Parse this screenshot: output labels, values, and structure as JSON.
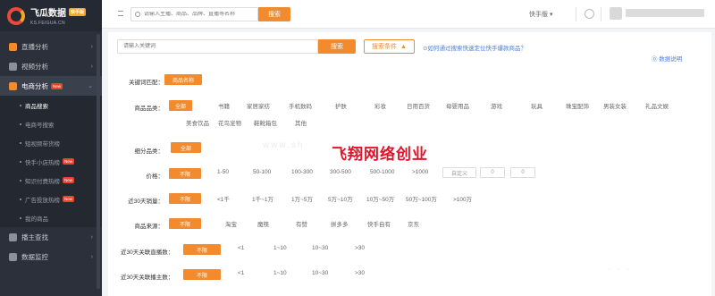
{
  "brand": {
    "title": "飞瓜数据",
    "badge": "快手版",
    "domain": "KS.FEIGUA.CN"
  },
  "sidebar": {
    "items": [
      {
        "label": "直播分析",
        "chevron": "›"
      },
      {
        "label": "视频分析",
        "chevron": "›"
      },
      {
        "label": "电商分析",
        "badge": "New",
        "chevron": "⌄"
      }
    ],
    "subitems": [
      {
        "label": "商品搜索"
      },
      {
        "label": "电商号搜索"
      },
      {
        "label": "短视频带货榜"
      },
      {
        "label": "快手小店热榜",
        "badge": "New"
      },
      {
        "label": "知识付费热榜",
        "badge": "New"
      },
      {
        "label": "广告投放热榜",
        "badge": "New"
      },
      {
        "label": "我的商品"
      }
    ],
    "bottom_items": [
      {
        "label": "播主查找",
        "chevron": "›"
      },
      {
        "label": "数据监控",
        "chevron": "›"
      }
    ]
  },
  "topbar": {
    "search_placeholder": "请输入主播、商品、品牌、直播等名称",
    "search_button": "搜索",
    "platform": "快手版 ▾"
  },
  "main": {
    "keyword_placeholder": "请输入关键词",
    "search_button": "搜索",
    "conditions_button": "搜索条件",
    "conditions_arrow": "▲",
    "help_link": "⊙如何通过搜索快速定位快手爆款商品？",
    "doc_link": "⓪ 数据说明",
    "keyword_match": {
      "label": "关键词匹配：",
      "selected": "商品名称"
    },
    "category": {
      "label": "商品品类：",
      "selected": "全部",
      "options_row1": [
        "书籍",
        "家居家纺",
        "手机数码",
        "护肤",
        "彩妆",
        "日用百货",
        "母婴用品",
        "游戏",
        "玩具",
        "珠宝配饰",
        "男装女装",
        "礼品文娱"
      ],
      "options_row2": [
        "美食饮品",
        "花鸟宠物",
        "鞋靴箱包",
        "其他"
      ]
    },
    "subcategory": {
      "label": "细分品类：",
      "selected": "全部"
    },
    "price": {
      "label": "价格：",
      "selected": "不限",
      "options": [
        "1-50",
        "50-100",
        "100-300",
        "300-500",
        "500-1000",
        ">1000"
      ],
      "custom": "自定义",
      "min": "0",
      "max": "0"
    },
    "sales_30d": {
      "label": "近30天销量：",
      "selected": "不限",
      "options": [
        "<1千",
        "1千~1万",
        "1万~5万",
        "5万~10万",
        "10万~50万",
        "50万~100万",
        ">100万"
      ]
    },
    "source": {
      "label": "商品来源：",
      "selected": "不限",
      "options": [
        "淘宝",
        "魔筷",
        "有赞",
        "拼多多",
        "快手自有",
        "京东"
      ]
    },
    "live_count": {
      "label": "近30天关联直播数：",
      "selected": "不限",
      "options": [
        "<1",
        "1~10",
        "10~30",
        ">30"
      ]
    },
    "streamer_count": {
      "label": "近30天关联播主数：",
      "selected": "不限",
      "options": [
        "<1",
        "1~10",
        "10~30",
        ">30"
      ]
    },
    "watermark_text": "飞翔网络创业",
    "watermark_faint": "www.sh",
    "faint_dots": "· · ·"
  },
  "colors": {
    "accent": "#f28a2e",
    "sidebar_bg": "#2b303b",
    "watermark": "#e0142a",
    "link": "#4a7fd6"
  }
}
